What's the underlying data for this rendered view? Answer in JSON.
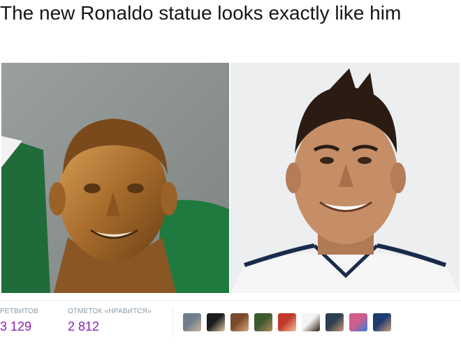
{
  "tweet": {
    "text": "The new Ronaldo statue looks exactly like him"
  },
  "stats": {
    "retweets_label": "РЕТВИТОВ",
    "retweets_value": "3 129",
    "likes_label": "ОТМЕТОК «НРАВИТСЯ»",
    "likes_value": "2 812"
  },
  "colors": {
    "stat_value": "#8b1fb3",
    "stat_label": "#8899a6"
  },
  "avatars": [
    {
      "icon": "avatar-icon",
      "colors": [
        "#6f7e8c",
        "#c9b79a"
      ]
    },
    {
      "icon": "avatar-icon",
      "colors": [
        "#1c1c1c",
        "#e0c8a8"
      ]
    },
    {
      "icon": "avatar-icon",
      "colors": [
        "#7a4a2e",
        "#d9a77a"
      ]
    },
    {
      "icon": "avatar-icon",
      "colors": [
        "#3d5a2e",
        "#b58a5c"
      ]
    },
    {
      "icon": "avatar-icon",
      "colors": [
        "#c0392b",
        "#f0c29a"
      ]
    },
    {
      "icon": "avatar-icon",
      "colors": [
        "#f4f4f4",
        "#2b1d14"
      ]
    },
    {
      "icon": "avatar-icon",
      "colors": [
        "#2c3e50",
        "#c99a72"
      ]
    },
    {
      "icon": "avatar-icon",
      "colors": [
        "#d35d8a",
        "#3a7bd5"
      ]
    },
    {
      "icon": "avatar-icon",
      "colors": [
        "#1f3a6e",
        "#c8a07a"
      ]
    }
  ]
}
